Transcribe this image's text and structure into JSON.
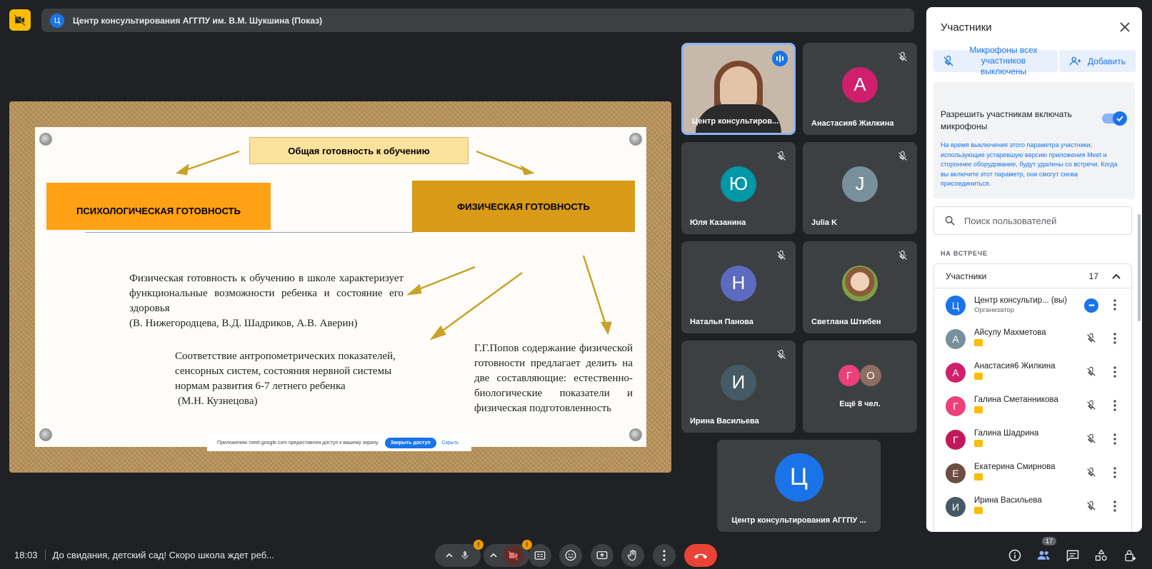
{
  "header": {
    "meeting_title": "Центр консультирования АГГПУ им. В.М. Шукшина (Показ)",
    "badge_letter": "Ц"
  },
  "slide": {
    "title": "Общая готовность к обучению",
    "left_box": "ПСИХОЛОГИЧЕСКАЯ ГОТОВНОСТЬ",
    "right_box": "ФИЗИЧЕСКАЯ ГОТОВНОСТЬ",
    "text1_line1": "Физическая готовность к обучению в школе характеризует функциональные возможности ребенка и состояние его здоровья",
    "text1_line2": "(В. Нижегородцева, В.Д. Шадриков, А.В. Аверин)",
    "text2_line1": "Соответствие антропометрических показателей, сенсорных систем, состояния нервной системы нормам развития 6-7 летнего ребенка",
    "text2_line2": "(М.Н. Кузнецова)",
    "text3": "Г.Г.Попов содержание физической готовности предлагает делить на две составляющие: естественно-биологические показатели и физическая подготовленность",
    "share_notice": "Приложению meet.google.com предоставлен доступ к вашему экрану.",
    "share_stop": "Закрыть доступ",
    "share_hide": "Скрыть"
  },
  "tiles": [
    {
      "name": "Центр консультиров...",
      "letter": "",
      "color": "#c7b9a9"
    },
    {
      "name": "Анастасия6 Жилкина",
      "letter": "А",
      "color": "#d01f6c"
    },
    {
      "name": "Юля Казанина",
      "letter": "Ю",
      "color": "#0097a7"
    },
    {
      "name": "Julia K",
      "letter": "J",
      "color": "#78909c"
    },
    {
      "name": "Наталья Панова",
      "letter": "Н",
      "color": "#5c6bc0"
    },
    {
      "name": "Светлана Штибен",
      "letter": "",
      "color": "#6d8a3a"
    },
    {
      "name": "Ирина Васильева",
      "letter": "И",
      "color": "#455a64"
    },
    {
      "name": "Ещё 8 чел.",
      "letter_a": "Г",
      "letter_b": "О",
      "color_a": "#ec407a",
      "color_b": "#8d6e63"
    },
    {
      "name": "Центр консультирования АГГПУ ...",
      "letter": "Ц",
      "color": "#1a73e8"
    }
  ],
  "panel": {
    "title": "Участники",
    "mute_all": "Микрофоны всех участников выключены",
    "add": "Добавить",
    "allow_mics_label": "Разрешить участникам включать микрофоны",
    "allow_mics_note": "На время выключения этого параметра участники, использующие устаревшую версию приложения Meet и стороннее оборудование, будут удалены со встречи. Когда вы включите этот параметр, они смогут снова присоединиться.",
    "search_placeholder": "Поиск пользователей",
    "section": "НА ВСТРЕЧЕ",
    "group_label": "Участники",
    "group_count": "17",
    "participants": [
      {
        "name": "Центр консультир...  (вы)",
        "sub": "Организатор",
        "letter": "Ц",
        "color": "#1a73e8"
      },
      {
        "name": "Айсулу Махметова",
        "letter": "А",
        "color": "#78909c"
      },
      {
        "name": "Анастасия6 Жилкина",
        "letter": "А",
        "color": "#d01f6c"
      },
      {
        "name": "Галина Сметанникова",
        "letter": "Г",
        "color": "#ec407a"
      },
      {
        "name": "Галина Шадрина",
        "letter": "Г",
        "color": "#c2185b"
      },
      {
        "name": "Екатерина Смирнова",
        "letter": "Е",
        "color": "#6d4c41"
      },
      {
        "name": "Ирина Васильева",
        "letter": "И",
        "color": "#455a64"
      }
    ]
  },
  "footer": {
    "time": "18:03",
    "meeting_name": "До свидания, детский сад! Скоро школа ждет реб...",
    "people_count": "17",
    "mic_warning": "!",
    "cam_warning": "!"
  }
}
